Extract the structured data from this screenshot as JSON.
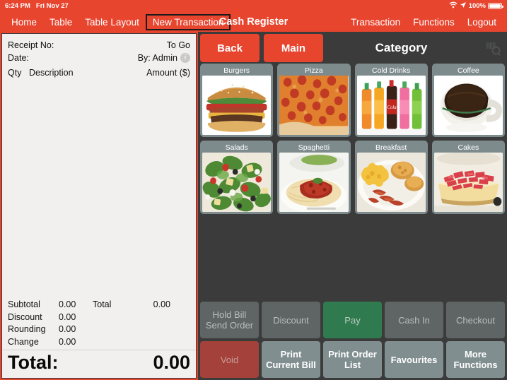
{
  "statusbar": {
    "time": "6:24 PM",
    "date": "Fri Nov 27",
    "battery_percent": "100%",
    "wifi_icon": "wifi-icon",
    "location_icon": "location-arrow-icon",
    "battery_icon": "battery-full-icon"
  },
  "navbar": {
    "items": [
      {
        "label": "Home",
        "selected": false
      },
      {
        "label": "Table",
        "selected": false
      },
      {
        "label": "Table Layout",
        "selected": false
      },
      {
        "label": "New Transaction",
        "selected": true
      }
    ],
    "title": "Cash Register",
    "right_items": [
      {
        "label": "Transaction"
      },
      {
        "label": "Functions"
      },
      {
        "label": "Logout"
      }
    ]
  },
  "receipt": {
    "receipt_no_label": "Receipt No:",
    "receipt_no_value": "",
    "order_type": "To Go",
    "date_label": "Date:",
    "date_value": "",
    "by_label": "By: Admin",
    "info_icon": "info-icon",
    "col_qty": "Qty",
    "col_description": "Description",
    "col_amount": "Amount ($)",
    "line_items": [],
    "totals": [
      {
        "label": "Subtotal",
        "value": "0.00"
      },
      {
        "label": "Discount",
        "value": "0.00"
      },
      {
        "label": "Rounding",
        "value": "0.00"
      },
      {
        "label": "Change",
        "value": "0.00"
      }
    ],
    "total_side_label": "Total",
    "total_side_value": "0.00",
    "grand_total_label": "Total:",
    "grand_total_value": "0.00"
  },
  "right_panel": {
    "back_label": "Back",
    "main_label": "Main",
    "category_title": "Category",
    "barcode_search_icon": "barcode-search-icon",
    "categories": [
      {
        "label": "Burgers",
        "image": "burger-image"
      },
      {
        "label": "Pizza",
        "image": "pizza-image"
      },
      {
        "label": "Cold Drinks",
        "image": "soda-bottles-image"
      },
      {
        "label": "Coffee",
        "image": "coffee-cup-image"
      },
      {
        "label": "Salads",
        "image": "salad-bowl-image"
      },
      {
        "label": "Spaghetti",
        "image": "spaghetti-plate-image"
      },
      {
        "label": "Breakfast",
        "image": "breakfast-plate-image"
      },
      {
        "label": "Cakes",
        "image": "strawberry-cake-image"
      }
    ],
    "actions": [
      {
        "label": "Hold Bill\nSend Order",
        "style": "gray"
      },
      {
        "label": "Discount",
        "style": "gray"
      },
      {
        "label": "Pay",
        "style": "green"
      },
      {
        "label": "Cash In",
        "style": "gray"
      },
      {
        "label": "Checkout",
        "style": "gray"
      },
      {
        "label": "Void",
        "style": "red"
      },
      {
        "label": "Print\nCurrent Bill",
        "style": "slate"
      },
      {
        "label": "Print Order\nList",
        "style": "slate"
      },
      {
        "label": "Favourites",
        "style": "slate"
      },
      {
        "label": "More\nFunctions",
        "style": "slate"
      }
    ]
  },
  "colors": {
    "brand_red": "#e8452f",
    "panel_dark": "#3b3b3b",
    "tile_slate": "#7e8b8d",
    "pay_green": "#2f7b4f",
    "void_red": "#a3413a",
    "receipt_bg": "#f1f0ee"
  }
}
